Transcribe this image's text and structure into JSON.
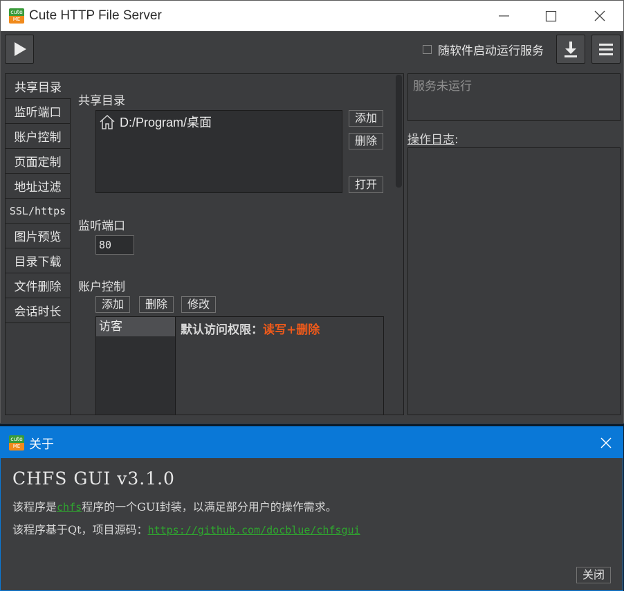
{
  "window": {
    "logo_top": "cute",
    "logo_bottom": "ME",
    "title": "Cute HTTP File Server"
  },
  "toolbar": {
    "autostart_label": "随软件启动运行服务"
  },
  "nav": {
    "items": [
      "共享目录",
      "监听端口",
      "账户控制",
      "页面定制",
      "地址过滤",
      "SSL/https",
      "图片预览",
      "目录下载",
      "文件删除",
      "会话时长"
    ]
  },
  "shared_dir": {
    "title": "共享目录",
    "path": "D:/Program/桌面",
    "add": "添加",
    "delete": "删除",
    "open": "打开"
  },
  "port": {
    "title": "监听端口",
    "value": "80"
  },
  "accounts": {
    "title": "账户控制",
    "add": "添加",
    "delete": "删除",
    "modify": "修改",
    "guest": "访客",
    "perm_label": "默认访问权限：",
    "perm_value": "读写+删除"
  },
  "status": {
    "text": "服务未运行",
    "log_label_u": "操作日志",
    "log_label_colon": ":"
  },
  "about": {
    "logo_top": "cute",
    "logo_bottom": "ME",
    "title": "关于",
    "heading": "CHFS GUI v3.1.0",
    "line1_pre": "该程序是",
    "line1_link": "chfs",
    "line1_post": "程序的一个GUI封装，以满足部分用户的操作需求。",
    "line2_pre": "该程序基于Qt，项目源码：",
    "line2_link": "https://github.com/docblue/chfsgui",
    "close_button": "关闭"
  }
}
